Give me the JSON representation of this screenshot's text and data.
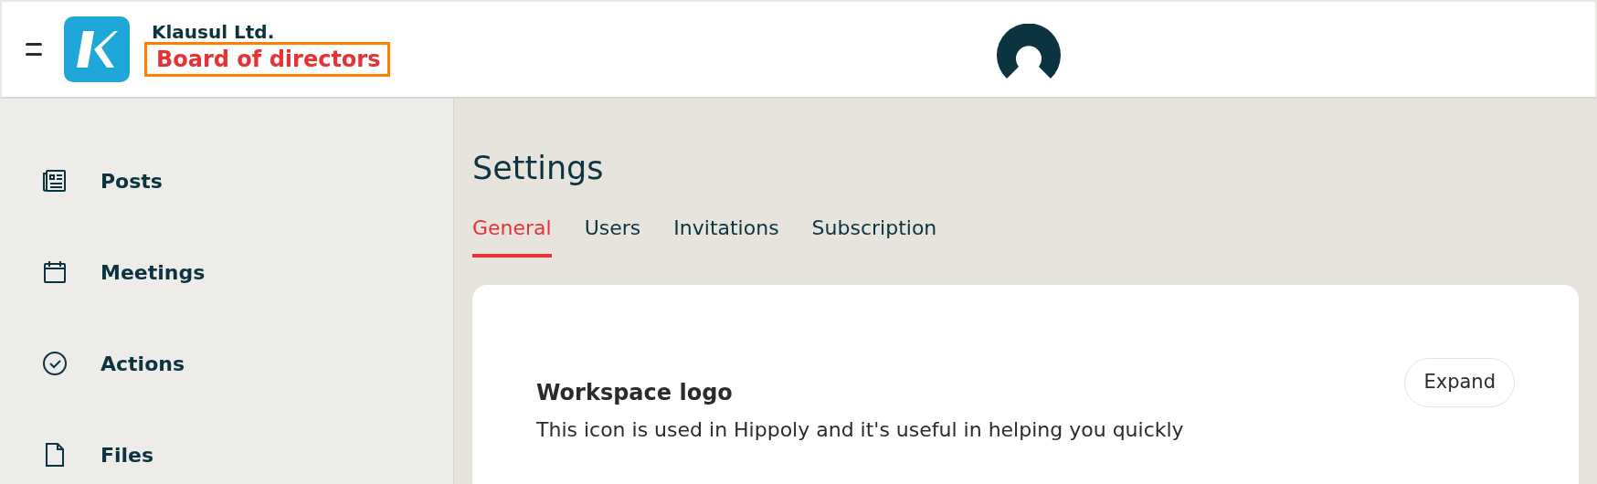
{
  "header": {
    "company": "Klausul Ltd.",
    "workspace": "Board of directors",
    "workspace_highlighted": true
  },
  "sidebar": {
    "items": [
      {
        "label": "Posts",
        "kind": "posts"
      },
      {
        "label": "Meetings",
        "kind": "meetings"
      },
      {
        "label": "Actions",
        "kind": "actions"
      },
      {
        "label": "Files",
        "kind": "files"
      }
    ]
  },
  "page": {
    "title": "Settings",
    "tabs": [
      {
        "label": "General",
        "selected": true
      },
      {
        "label": "Users",
        "selected": false
      },
      {
        "label": "Invitations",
        "selected": false
      },
      {
        "label": "Subscription",
        "selected": false
      }
    ],
    "section": {
      "title": "Workspace logo",
      "description": "This icon is used in Hippoly and it's useful in helping you quickly",
      "button": "Expand"
    }
  }
}
